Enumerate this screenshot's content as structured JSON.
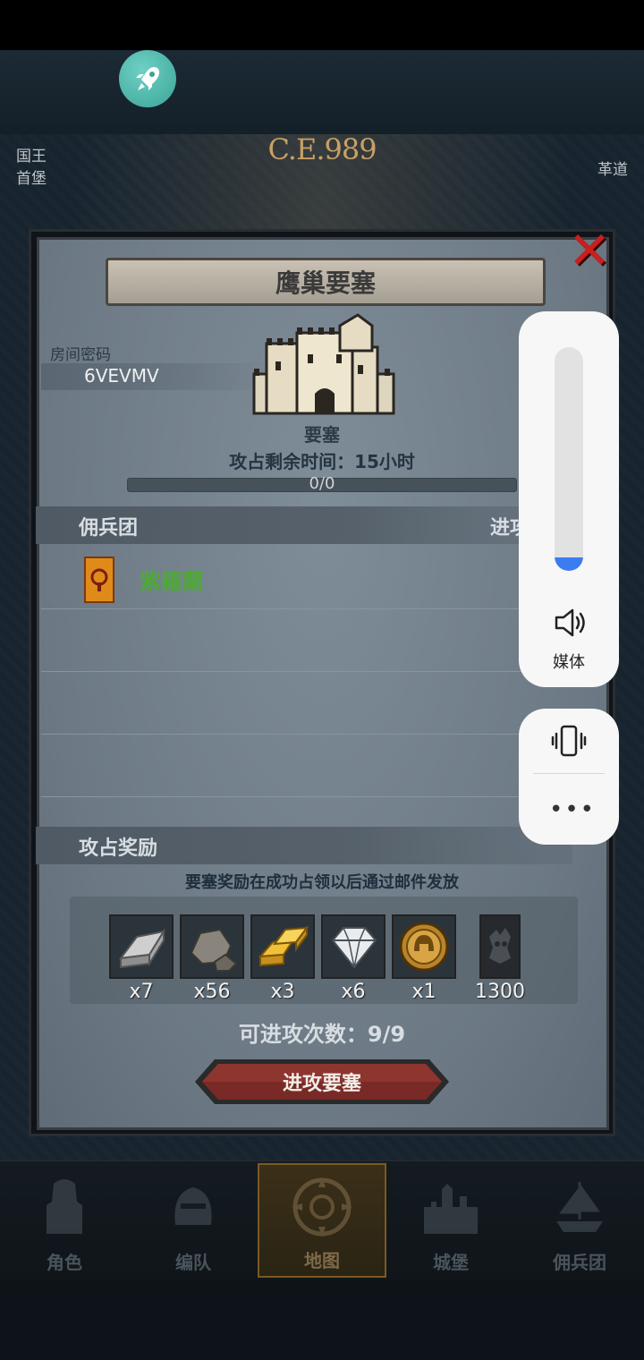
{
  "map": {
    "era": "C.E.989",
    "left_label_1": "国王",
    "left_label_2": "首堡",
    "right_label_1": "革道"
  },
  "dialog": {
    "title": "鹰巢要塞",
    "room_code_label": "房间密码",
    "room_code": "6VEVMV",
    "fortress_name": "要塞",
    "remaining_time": "攻占剩余时间：15小时",
    "progress_text": "0/0",
    "close_icon": "close-x"
  },
  "mercenary": {
    "section_title": "佣兵团",
    "column_header": "进攻",
    "guilds": [
      {
        "name": "紫羅蘭",
        "color": "#4fa838"
      }
    ]
  },
  "rewards": {
    "section_title": "攻占奖励",
    "note": "要塞奖励在成功占领以后通过邮件发放",
    "items": [
      {
        "icon": "iron-ingot-icon",
        "qty": "x7"
      },
      {
        "icon": "stone-ore-icon",
        "qty": "x56"
      },
      {
        "icon": "gold-bar-icon",
        "qty": "x3"
      },
      {
        "icon": "diamond-icon",
        "qty": "x6"
      },
      {
        "icon": "gold-medal-icon",
        "qty": "x1"
      },
      {
        "icon": "dark-emblem-icon",
        "qty": "1300"
      }
    ],
    "attack_count": "可进攻次数：9/9"
  },
  "attack_button": {
    "label": "进攻要塞"
  },
  "bottom_nav": [
    {
      "label": "角色",
      "active": false
    },
    {
      "label": "编队",
      "active": false
    },
    {
      "label": "地图",
      "active": true
    },
    {
      "label": "城堡",
      "active": false
    },
    {
      "label": "佣兵团",
      "active": false
    }
  ],
  "volume": {
    "label": "媒体",
    "level": 0.06,
    "accent": "#3b7cf0"
  },
  "colors": {
    "guild_name": "#4fa838",
    "close": "#c81f1f",
    "button": "#7a2a26"
  }
}
